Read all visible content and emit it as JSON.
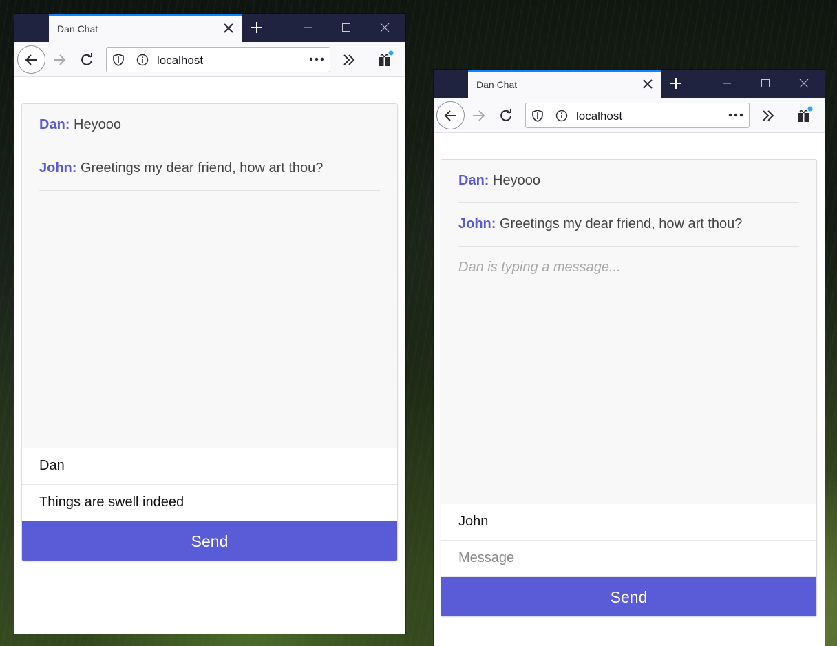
{
  "windows": [
    {
      "tab_title": "Dan Chat",
      "url": "localhost",
      "messages": [
        {
          "author": "Dan:",
          "text": "Heyooo"
        },
        {
          "author": "John:",
          "text": "Greetings my dear friend, how art thou?"
        }
      ],
      "typing_indicator": "",
      "name_value": "Dan",
      "message_value": "Things are swell indeed",
      "message_placeholder": "Message",
      "send_label": "Send"
    },
    {
      "tab_title": "Dan Chat",
      "url": "localhost",
      "messages": [
        {
          "author": "Dan:",
          "text": "Heyooo"
        },
        {
          "author": "John:",
          "text": "Greetings my dear friend, how art thou?"
        }
      ],
      "typing_indicator": "Dan is typing a message...",
      "name_value": "John",
      "message_value": "",
      "message_placeholder": "Message",
      "send_label": "Send"
    }
  ],
  "icons": {
    "tab_close": "close-icon",
    "new_tab": "plus-icon",
    "minimize": "minimize-icon",
    "maximize": "maximize-icon",
    "window_close": "close-icon",
    "back": "arrow-left-icon",
    "forward": "arrow-right-icon",
    "reload": "reload-icon",
    "tracking_protection": "shield-icon",
    "site_info": "info-icon",
    "page_actions": "more-dots-icon",
    "overflow": "chevrons-right-icon",
    "whats_new": "gift-icon"
  },
  "colors": {
    "accent": "#5a5bd6",
    "titlebar": "#202340",
    "tab_highlight": "#0a84ff",
    "typing_text": "#a8a8a8"
  }
}
